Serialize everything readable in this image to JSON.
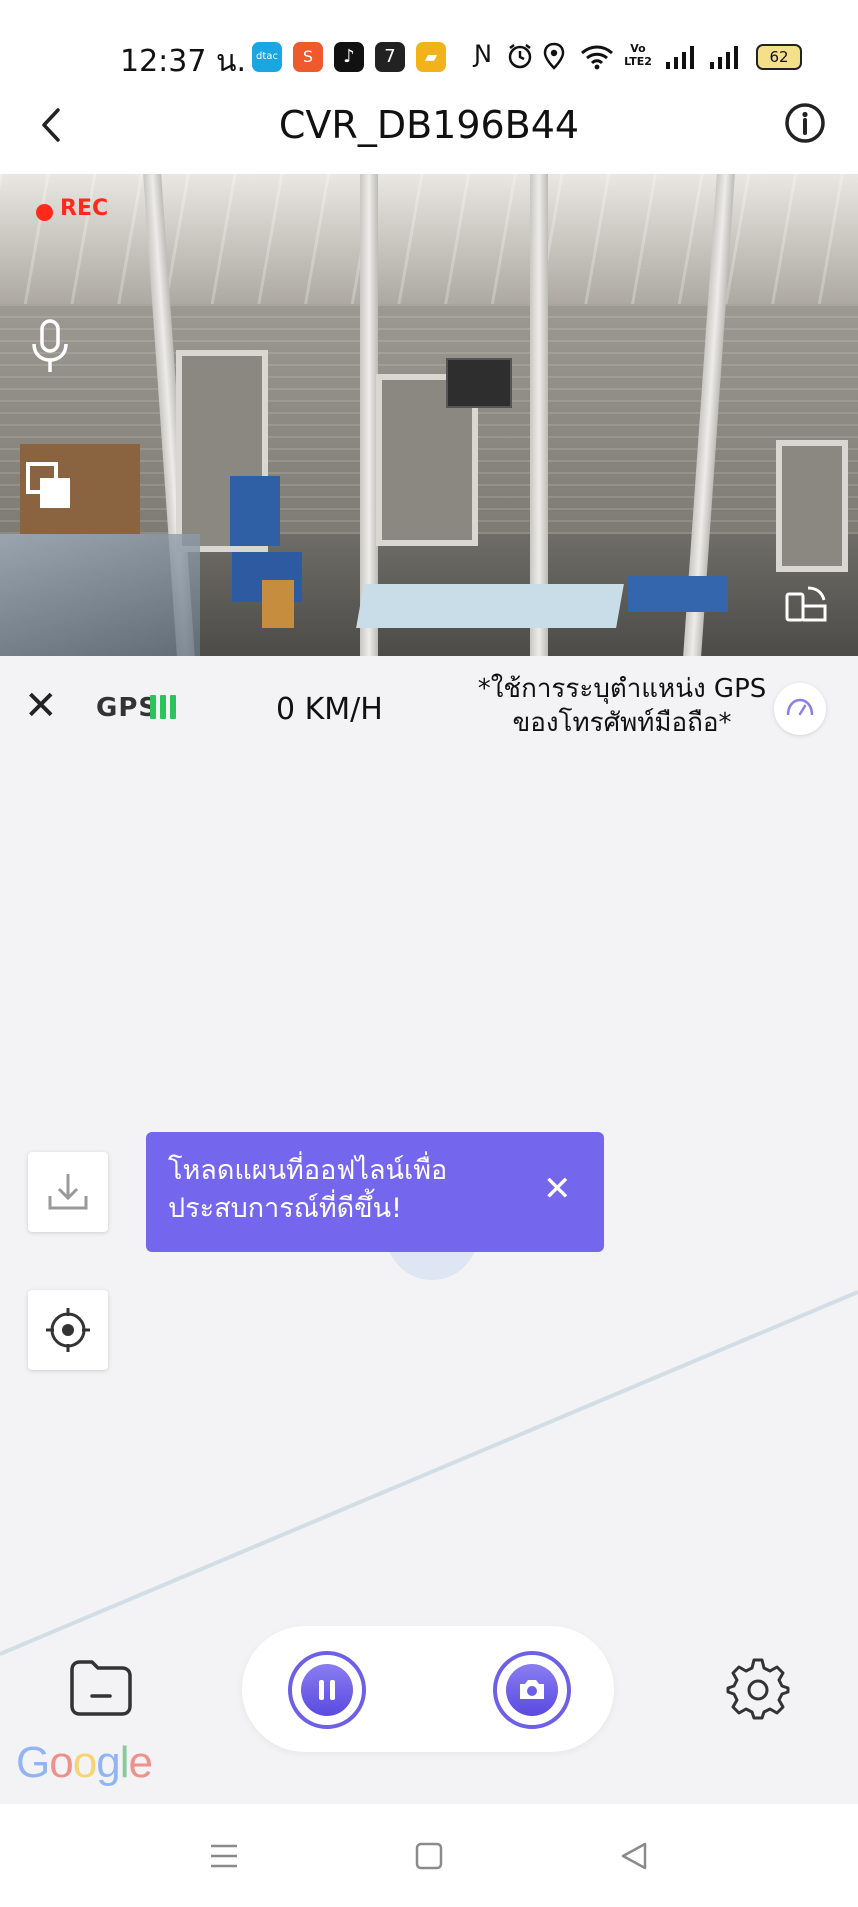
{
  "status_bar": {
    "time": "12:37 น.",
    "app_icons": [
      "dtac",
      "shopee",
      "tiktok",
      "seven-eleven",
      "food-app"
    ],
    "system_icons": [
      "nfc-icon",
      "alarm-icon",
      "location-icon",
      "wifi-icon",
      "volte-icon",
      "signal-icon",
      "signal-icon"
    ],
    "volte": "Vo LTE2",
    "battery": "62"
  },
  "header": {
    "title": "CVR_DB196B44",
    "back_icon": "chevron-left-icon",
    "info_icon": "info-icon"
  },
  "camera": {
    "rec_label": "REC",
    "icons": [
      "microphone-icon",
      "picture-in-picture-icon",
      "rotate-screen-icon"
    ]
  },
  "speed_bar": {
    "gps_label": "GPS",
    "gps_strength": 3,
    "speed": "0 KM/H",
    "gps_note": "*ใช้การระบุตำแหน่ง GPS ของโทรศัพท์มือถือ*"
  },
  "map": {
    "tooltip_text": "โหลดแผนที่ออฟไลน์เพื่อประสบการณ์ที่ดีขึ้น!",
    "google_logo": "Google"
  },
  "colors": {
    "accent": "#7566ee",
    "rec_red": "#ff2a1c",
    "gps_green": "#2bc45a",
    "map_bg": "#f3f2f4"
  }
}
